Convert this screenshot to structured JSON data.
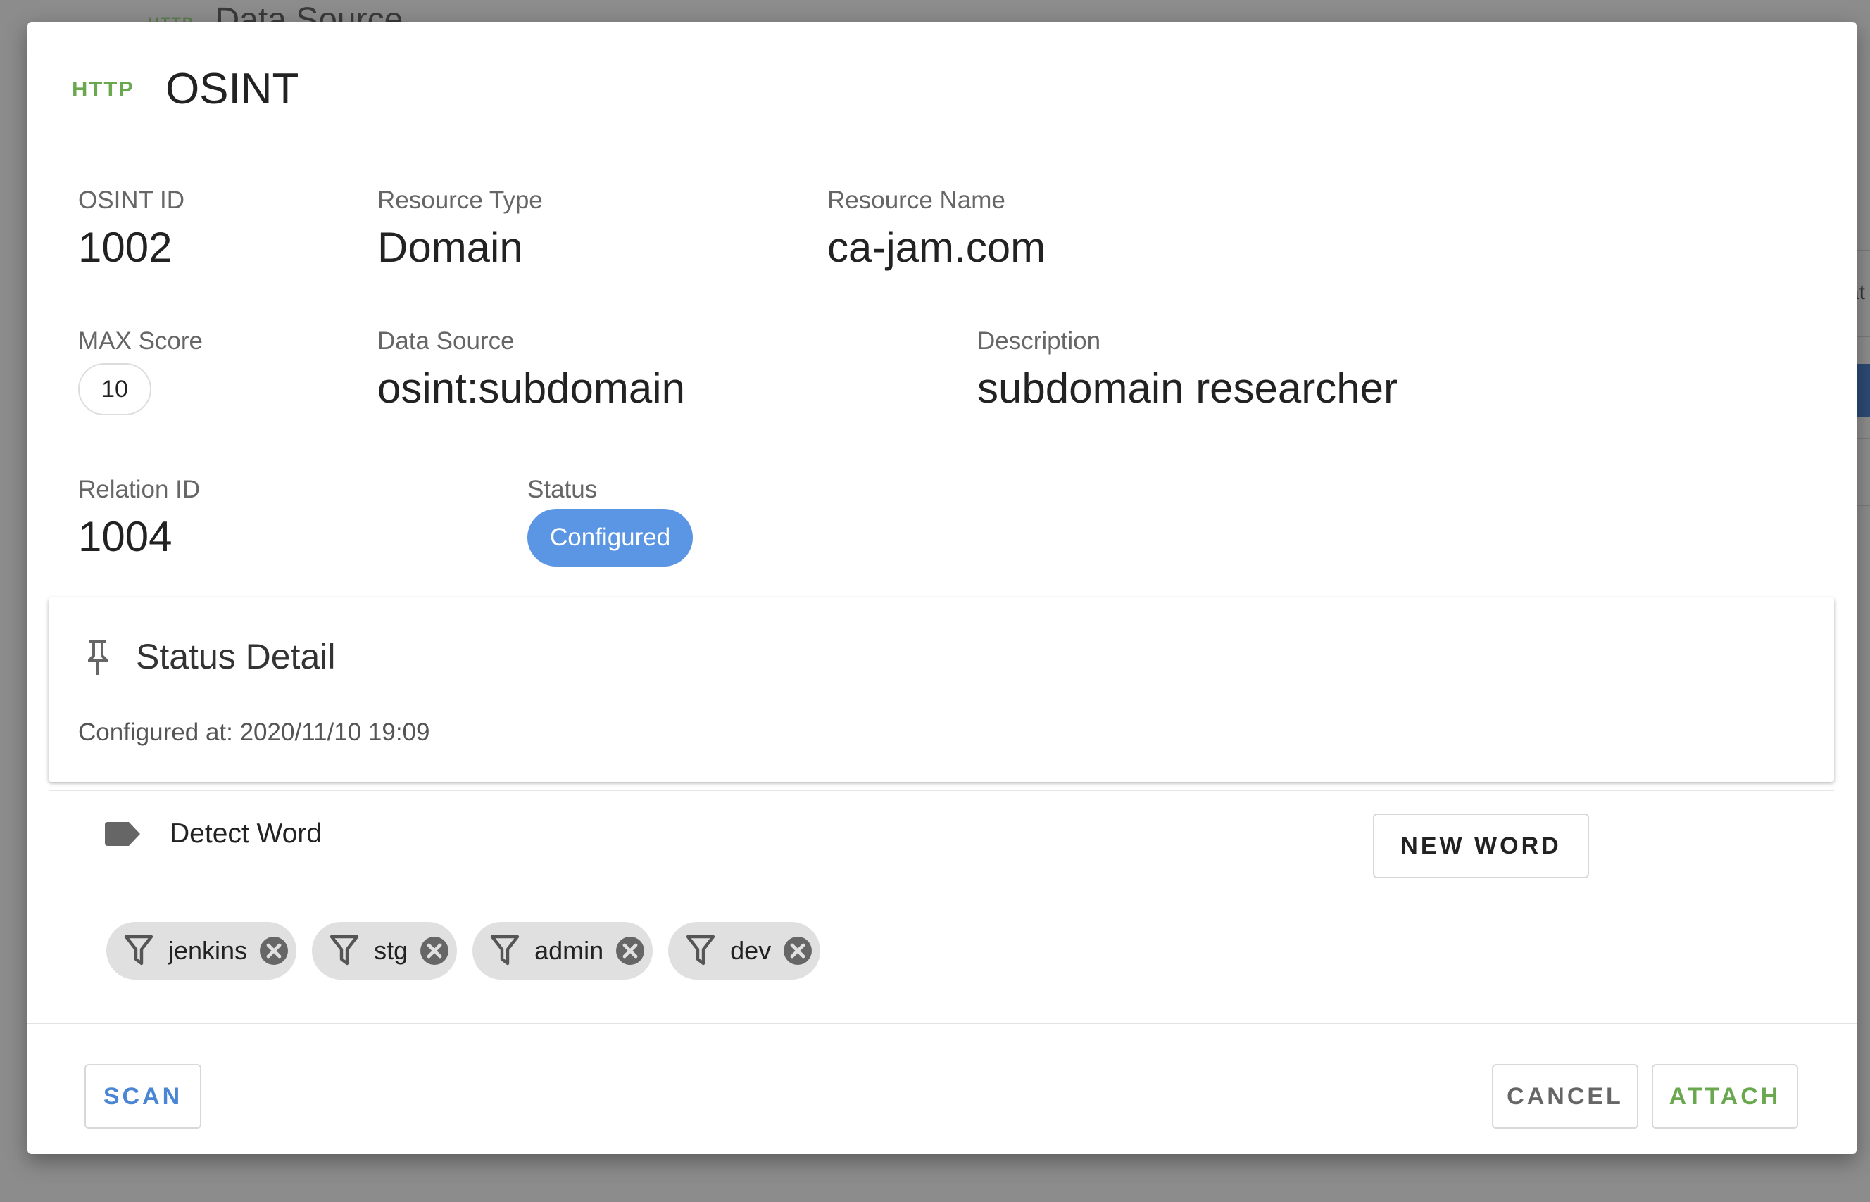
{
  "background": {
    "tag": "HTTP",
    "title": "Data Source",
    "side_text": "at"
  },
  "dialog": {
    "tag": "HTTP",
    "title": "OSINT",
    "fields": {
      "osint_id": {
        "label": "OSINT ID",
        "value": "1002"
      },
      "resource_type": {
        "label": "Resource Type",
        "value": "Domain"
      },
      "resource_name": {
        "label": "Resource Name",
        "value": "ca-jam.com"
      },
      "max_score": {
        "label": "MAX Score",
        "value": "10"
      },
      "data_source": {
        "label": "Data Source",
        "value": "osint:subdomain"
      },
      "description": {
        "label": "Description",
        "value": "subdomain researcher"
      },
      "relation_id": {
        "label": "Relation ID",
        "value": "1004"
      },
      "status": {
        "label": "Status",
        "value": "Configured",
        "color": "#5a96e3"
      }
    },
    "status_detail": {
      "title": "Status Detail",
      "icon": "pin-icon",
      "text": "Configured at: 2020/11/10 19:09"
    },
    "detect_word": {
      "title": "Detect Word",
      "icon": "label-icon",
      "new_word_label": "NEW WORD",
      "words": [
        "jenkins",
        "stg",
        "admin",
        "dev"
      ]
    },
    "actions": {
      "scan_label": "SCAN",
      "cancel_label": "CANCEL",
      "attach_label": "ATTACH"
    }
  },
  "colors": {
    "accent_green": "#6aa84f",
    "accent_blue": "#4a86d4",
    "status_chip": "#5a96e3",
    "overlay": "#8a8a8a"
  }
}
